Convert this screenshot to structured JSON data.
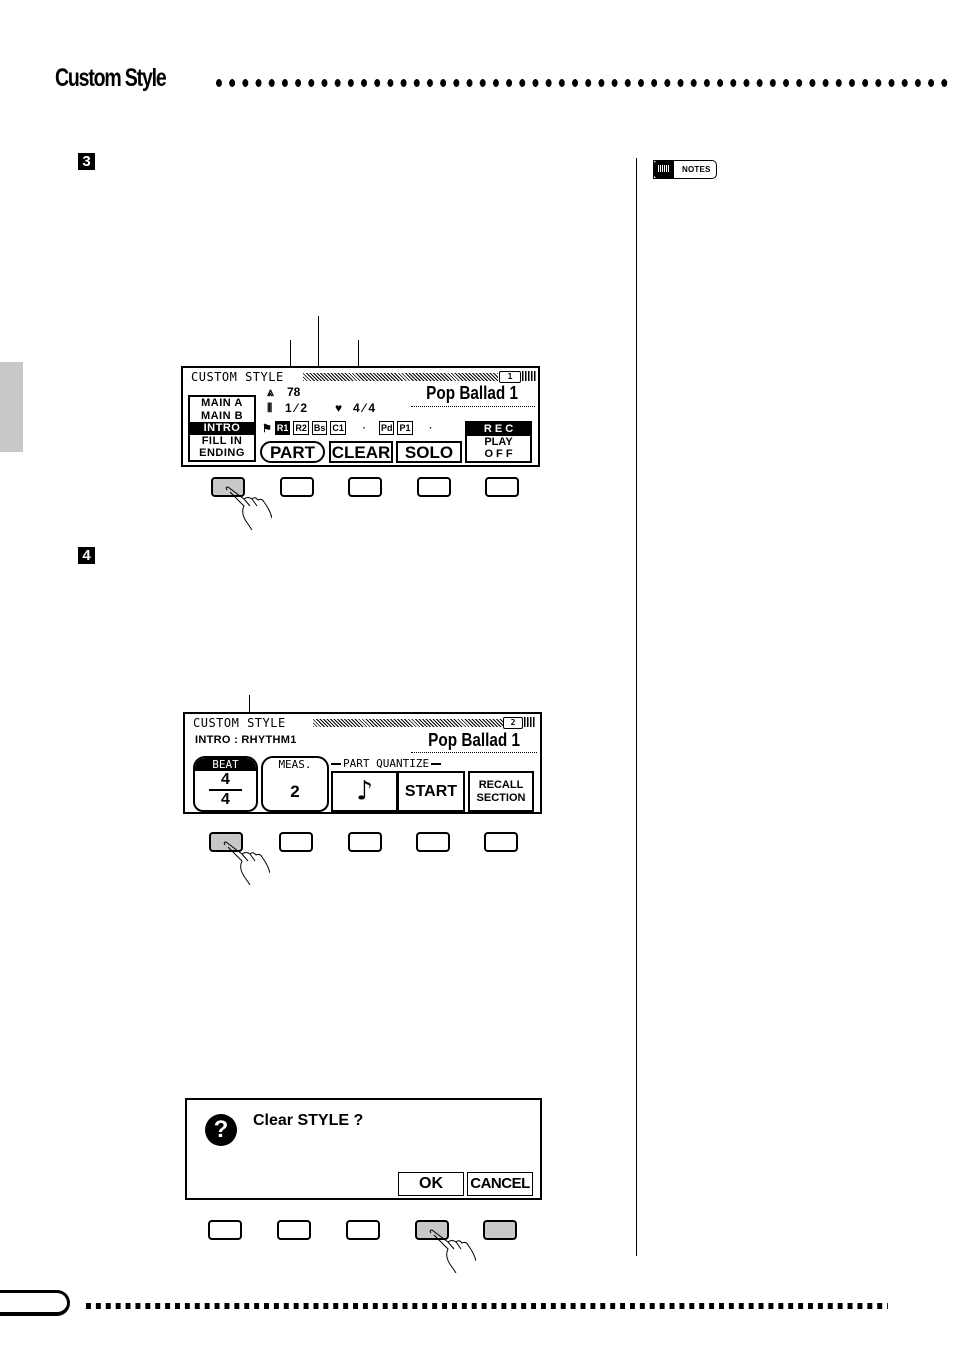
{
  "header": {
    "title": "Custom Style"
  },
  "steps": [
    {
      "number": "3"
    },
    {
      "number": "4"
    }
  ],
  "notes": {
    "label": "NOTES"
  },
  "lcd1": {
    "title": "CUSTOM STYLE",
    "page": "1",
    "tempo": "78",
    "measure": "1 ⁄ 2",
    "beat": "4 ⁄ 4",
    "song": "Pop Ballad 1",
    "sections": [
      {
        "label": "MAIN A",
        "selected": false
      },
      {
        "label": "MAIN B",
        "selected": false
      },
      {
        "label": "INTRO",
        "selected": true
      },
      {
        "label": "FILL IN",
        "selected": false
      },
      {
        "label": "ENDING",
        "selected": false
      }
    ],
    "parts": [
      {
        "label": "R1",
        "active": true
      },
      {
        "label": "R2",
        "active": false
      },
      {
        "label": "Bs",
        "active": false
      },
      {
        "label": "C1",
        "active": false
      },
      {
        "label": "·",
        "active": false,
        "separator": true
      },
      {
        "label": "Pd",
        "active": false
      },
      {
        "label": "P1",
        "active": false
      },
      {
        "label": "·",
        "active": false,
        "separator": true
      }
    ],
    "buttons": [
      "PART",
      "CLEAR",
      "SOLO"
    ],
    "mode": {
      "rec": "R E C",
      "play": "PLAY",
      "off": "O F F"
    }
  },
  "lcd2": {
    "title": "CUSTOM STYLE",
    "page": "2",
    "part_info": "INTRO : RHYTHM1",
    "song": "Pop Ballad 1",
    "beat_label": "BEAT",
    "beat_num": "4",
    "beat_den": "4",
    "meas_label": "MEAS.",
    "meas_value": "2",
    "quantize_label": "PART QUANTIZE",
    "quantize_note_icon": "sixteenth-note",
    "start_label": "START",
    "recall_label_1": "RECALL",
    "recall_label_2": "SECTION"
  },
  "dialog": {
    "message": "Clear STYLE ?",
    "ok_label": "OK",
    "cancel_label": "CANCEL"
  }
}
